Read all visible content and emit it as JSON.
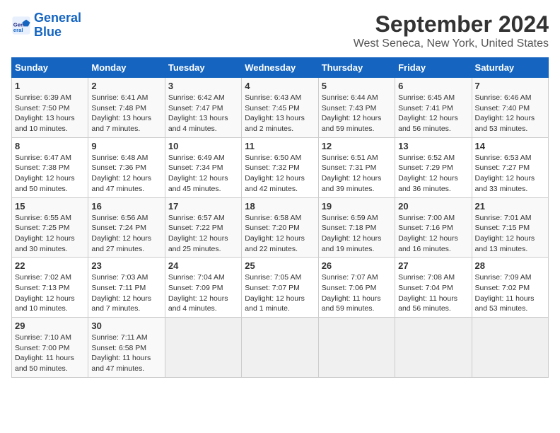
{
  "logo": {
    "line1": "General",
    "line2": "Blue"
  },
  "title": "September 2024",
  "subtitle": "West Seneca, New York, United States",
  "days_of_week": [
    "Sunday",
    "Monday",
    "Tuesday",
    "Wednesday",
    "Thursday",
    "Friday",
    "Saturday"
  ],
  "weeks": [
    [
      {
        "day": "1",
        "info": "Sunrise: 6:39 AM\nSunset: 7:50 PM\nDaylight: 13 hours\nand 10 minutes."
      },
      {
        "day": "2",
        "info": "Sunrise: 6:41 AM\nSunset: 7:48 PM\nDaylight: 13 hours\nand 7 minutes."
      },
      {
        "day": "3",
        "info": "Sunrise: 6:42 AM\nSunset: 7:47 PM\nDaylight: 13 hours\nand 4 minutes."
      },
      {
        "day": "4",
        "info": "Sunrise: 6:43 AM\nSunset: 7:45 PM\nDaylight: 13 hours\nand 2 minutes."
      },
      {
        "day": "5",
        "info": "Sunrise: 6:44 AM\nSunset: 7:43 PM\nDaylight: 12 hours\nand 59 minutes."
      },
      {
        "day": "6",
        "info": "Sunrise: 6:45 AM\nSunset: 7:41 PM\nDaylight: 12 hours\nand 56 minutes."
      },
      {
        "day": "7",
        "info": "Sunrise: 6:46 AM\nSunset: 7:40 PM\nDaylight: 12 hours\nand 53 minutes."
      }
    ],
    [
      {
        "day": "8",
        "info": "Sunrise: 6:47 AM\nSunset: 7:38 PM\nDaylight: 12 hours\nand 50 minutes."
      },
      {
        "day": "9",
        "info": "Sunrise: 6:48 AM\nSunset: 7:36 PM\nDaylight: 12 hours\nand 47 minutes."
      },
      {
        "day": "10",
        "info": "Sunrise: 6:49 AM\nSunset: 7:34 PM\nDaylight: 12 hours\nand 45 minutes."
      },
      {
        "day": "11",
        "info": "Sunrise: 6:50 AM\nSunset: 7:32 PM\nDaylight: 12 hours\nand 42 minutes."
      },
      {
        "day": "12",
        "info": "Sunrise: 6:51 AM\nSunset: 7:31 PM\nDaylight: 12 hours\nand 39 minutes."
      },
      {
        "day": "13",
        "info": "Sunrise: 6:52 AM\nSunset: 7:29 PM\nDaylight: 12 hours\nand 36 minutes."
      },
      {
        "day": "14",
        "info": "Sunrise: 6:53 AM\nSunset: 7:27 PM\nDaylight: 12 hours\nand 33 minutes."
      }
    ],
    [
      {
        "day": "15",
        "info": "Sunrise: 6:55 AM\nSunset: 7:25 PM\nDaylight: 12 hours\nand 30 minutes."
      },
      {
        "day": "16",
        "info": "Sunrise: 6:56 AM\nSunset: 7:24 PM\nDaylight: 12 hours\nand 27 minutes."
      },
      {
        "day": "17",
        "info": "Sunrise: 6:57 AM\nSunset: 7:22 PM\nDaylight: 12 hours\nand 25 minutes."
      },
      {
        "day": "18",
        "info": "Sunrise: 6:58 AM\nSunset: 7:20 PM\nDaylight: 12 hours\nand 22 minutes."
      },
      {
        "day": "19",
        "info": "Sunrise: 6:59 AM\nSunset: 7:18 PM\nDaylight: 12 hours\nand 19 minutes."
      },
      {
        "day": "20",
        "info": "Sunrise: 7:00 AM\nSunset: 7:16 PM\nDaylight: 12 hours\nand 16 minutes."
      },
      {
        "day": "21",
        "info": "Sunrise: 7:01 AM\nSunset: 7:15 PM\nDaylight: 12 hours\nand 13 minutes."
      }
    ],
    [
      {
        "day": "22",
        "info": "Sunrise: 7:02 AM\nSunset: 7:13 PM\nDaylight: 12 hours\nand 10 minutes."
      },
      {
        "day": "23",
        "info": "Sunrise: 7:03 AM\nSunset: 7:11 PM\nDaylight: 12 hours\nand 7 minutes."
      },
      {
        "day": "24",
        "info": "Sunrise: 7:04 AM\nSunset: 7:09 PM\nDaylight: 12 hours\nand 4 minutes."
      },
      {
        "day": "25",
        "info": "Sunrise: 7:05 AM\nSunset: 7:07 PM\nDaylight: 12 hours\nand 1 minute."
      },
      {
        "day": "26",
        "info": "Sunrise: 7:07 AM\nSunset: 7:06 PM\nDaylight: 11 hours\nand 59 minutes."
      },
      {
        "day": "27",
        "info": "Sunrise: 7:08 AM\nSunset: 7:04 PM\nDaylight: 11 hours\nand 56 minutes."
      },
      {
        "day": "28",
        "info": "Sunrise: 7:09 AM\nSunset: 7:02 PM\nDaylight: 11 hours\nand 53 minutes."
      }
    ],
    [
      {
        "day": "29",
        "info": "Sunrise: 7:10 AM\nSunset: 7:00 PM\nDaylight: 11 hours\nand 50 minutes."
      },
      {
        "day": "30",
        "info": "Sunrise: 7:11 AM\nSunset: 6:58 PM\nDaylight: 11 hours\nand 47 minutes."
      },
      {
        "day": "",
        "info": ""
      },
      {
        "day": "",
        "info": ""
      },
      {
        "day": "",
        "info": ""
      },
      {
        "day": "",
        "info": ""
      },
      {
        "day": "",
        "info": ""
      }
    ]
  ]
}
